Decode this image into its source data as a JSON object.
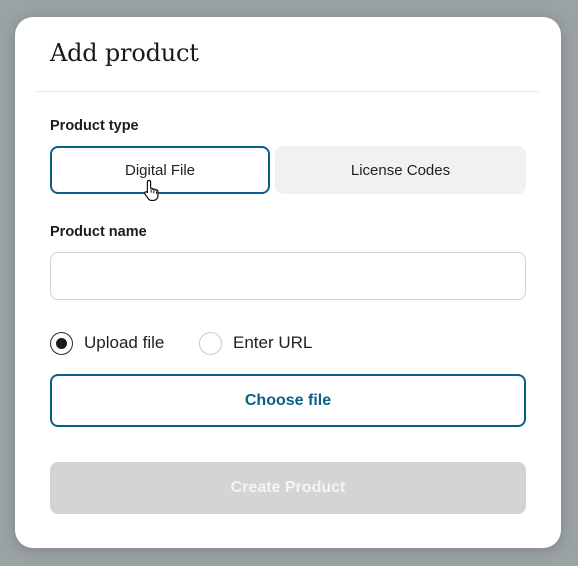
{
  "dialog": {
    "title": "Add product"
  },
  "product_type": {
    "label": "Product type",
    "options": [
      {
        "label": "Digital File",
        "selected": true
      },
      {
        "label": "License Codes",
        "selected": false
      }
    ]
  },
  "product_name": {
    "label": "Product name",
    "value": "",
    "placeholder": ""
  },
  "source": {
    "options": [
      {
        "label": "Upload file",
        "checked": true
      },
      {
        "label": "Enter URL",
        "checked": false
      }
    ]
  },
  "buttons": {
    "choose_file": "Choose file",
    "create_product": "Create Product"
  },
  "colors": {
    "accent": "#0a5f8a",
    "disabled_button": "#d4d4d4",
    "backdrop": "#9aa2a6"
  },
  "icons": {
    "cursor": "hand-pointer-icon"
  }
}
